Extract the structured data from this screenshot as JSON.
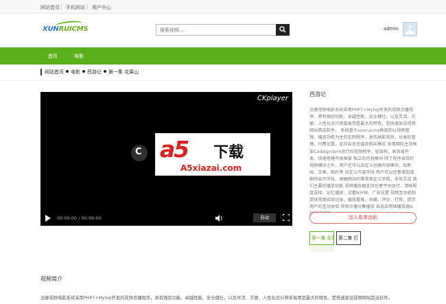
{
  "topbar": {
    "links": [
      "网站首页",
      "手机网站",
      "用户中心"
    ]
  },
  "header": {
    "logo_part1": "XUN",
    "logo_part2": "RUICMS",
    "search_placeholder": "搜索视频...",
    "username": "admin",
    "avatar_glyph": "?"
  },
  "nav": {
    "items": [
      "首页",
      "电影"
    ]
  },
  "breadcrumb": [
    "网站首页",
    "电影",
    "西游记",
    "第一集 花果山"
  ],
  "player": {
    "brand": "CKplayer",
    "logo_letter": "C",
    "time": "00:00:00 / 00:00:00",
    "auto_label": "自动"
  },
  "watermark": {
    "main": "a5",
    "cn": "下载",
    "url": "A5xiazai.com"
  },
  "sidebar": {
    "title": "西游记",
    "description": "迅睿视频电影系统采用PHP7+MySql开发的视频点播程序，具有强劲功能、卓越性能、安全健壮，以及灵活、方便、人性化设计简单易用是最大的特色，是快速架设视频网站首选软件。 系统基于xunruicms框架的以视频管理、播放功能为主的定制程序，发布高能视频，分类的管理，付费设置，支持会员充值及购买模式 采用国际主流框架Codeigniter4运行的视频程序，轻架构，高效易开发，快速搭建开发框架 独立的内容模块 除了程序自带的视频模块之外，用户还可以自定义创建内容模块，如新闻、文章、图片等 自定义内容字段 用户可以任意增加或删除显示字段，根据网站的需求来定义字段，非常灵活 我们主要的播放功能 视频播放器支持任意平台运行，清晰程度选择、记忆播放、试看N分钟、广告设置 视频互动机制 提供视频阅读记录、播放看客、收藏、评论、打赏，提示用户的互动体验 视频点播分集播放 自选应用插播放器& 定制播放器",
    "add_button": "加入看单追剧",
    "episodes": [
      "第一集 花果山",
      "第二集 打"
    ]
  },
  "intro": {
    "title": "视频简介",
    "text": "迅睿视频电影系统采用PHP7+MySql开发的视频点播程序，具有强劲功能、卓越性能、安全健壮，以及灵活、方便、人性化设计简单易用是最大的特色，是快速架设视频网站首选软件。"
  }
}
